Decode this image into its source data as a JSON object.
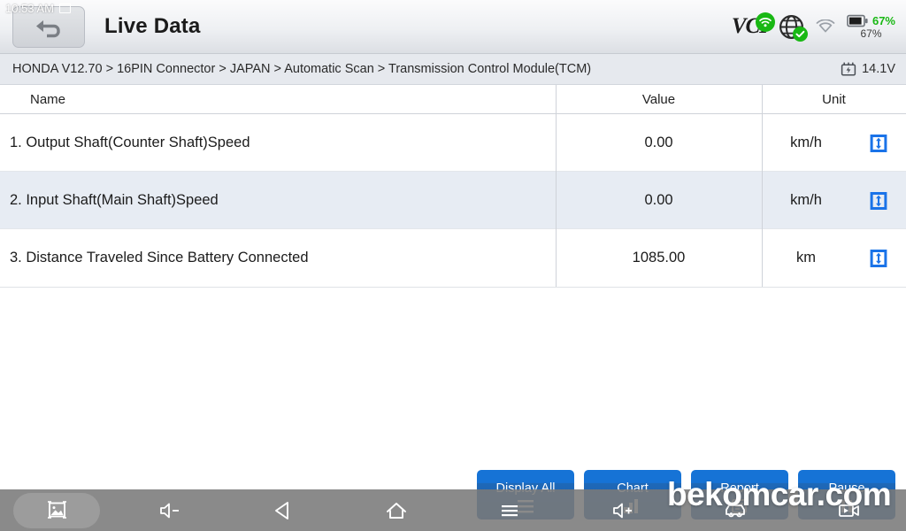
{
  "statusbar": {
    "time": "10:53 AM",
    "screenshot_icon": "screenshot-icon"
  },
  "titlebar": {
    "back_icon": "back-arrow-icon",
    "title": "Live Data",
    "vci_label": "VCI",
    "vci_icon": "vci-wifi-icon",
    "globe_icon": "globe-icon",
    "globe_check_icon": "check-badge-icon",
    "wifi_icon": "wifi-icon",
    "battery_icon": "battery-icon",
    "battery_percent_top": "67%",
    "battery_percent_bottom": "67%"
  },
  "breadcrumb": {
    "path": "HONDA V12.70 > 16PIN Connector  > JAPAN  > Automatic Scan  > Transmission Control Module(TCM)",
    "voltage_icon": "battery-bolt-icon",
    "voltage": "14.1V"
  },
  "table": {
    "headers": {
      "name": "Name",
      "value": "Value",
      "unit": "Unit"
    },
    "rows": [
      {
        "name": "1. Output Shaft(Counter Shaft)Speed",
        "value": "0.00",
        "unit": "km/h",
        "action_icon": "range-limits-icon"
      },
      {
        "name": "2. Input Shaft(Main Shaft)Speed",
        "value": "0.00",
        "unit": "km/h",
        "action_icon": "range-limits-icon"
      },
      {
        "name": "3. Distance Traveled Since Battery Connected",
        "value": "1085.00",
        "unit": "km",
        "action_icon": "range-limits-icon"
      }
    ]
  },
  "actions": [
    {
      "label": "Display All",
      "icon": "list-icon"
    },
    {
      "label": "Chart",
      "icon": "chart-icon"
    },
    {
      "label": "Report",
      "icon": "report-icon"
    },
    {
      "label": "Pause",
      "icon": "pause-icon"
    }
  ],
  "navbar": [
    {
      "icon": "screenshot-icon",
      "active": true
    },
    {
      "icon": "volume-down-icon",
      "active": false
    },
    {
      "icon": "back-triangle-icon",
      "active": false
    },
    {
      "icon": "home-icon",
      "active": false
    },
    {
      "icon": "menu-icon",
      "active": false
    },
    {
      "icon": "volume-up-icon",
      "active": false
    },
    {
      "icon": "car-icon",
      "active": false
    },
    {
      "icon": "video-record-icon",
      "active": false
    }
  ],
  "watermark": {
    "text": "bekomcar.com"
  },
  "colors": {
    "accent_blue": "#1673d6",
    "icon_blue": "#1a73e8",
    "status_green": "#19b814",
    "row_alt": "#e7ecf3",
    "breadcrumb_bg": "#e6e9ee"
  }
}
